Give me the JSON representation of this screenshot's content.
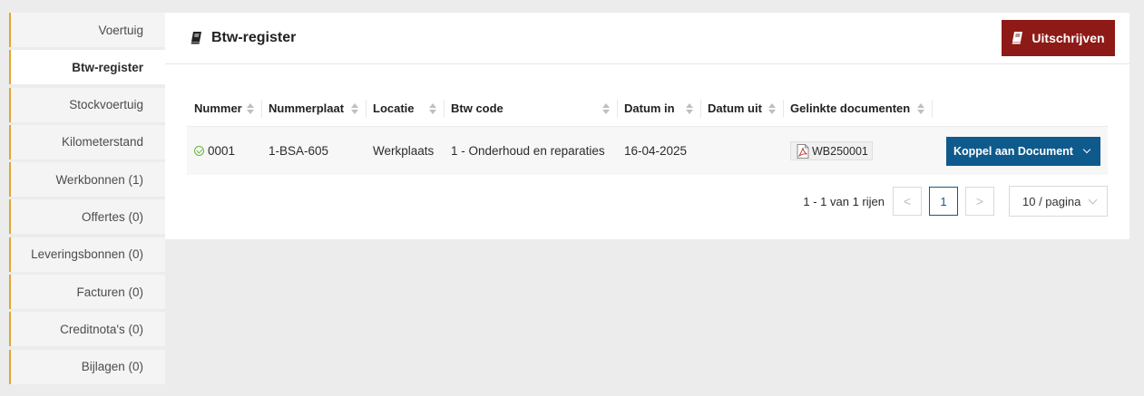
{
  "sidebar": {
    "items": [
      {
        "label": "Voertuig",
        "active": false
      },
      {
        "label": "Btw-register",
        "active": true
      },
      {
        "label": "Stockvoertuig",
        "active": false
      },
      {
        "label": "Kilometerstand",
        "active": false
      },
      {
        "label": "Werkbonnen (1)",
        "active": false
      },
      {
        "label": "Offertes (0)",
        "active": false
      },
      {
        "label": "Leveringsbonnen (0)",
        "active": false
      },
      {
        "label": "Facturen (0)",
        "active": false
      },
      {
        "label": "Creditnota's (0)",
        "active": false
      },
      {
        "label": "Bijlagen (0)",
        "active": false
      }
    ],
    "accent_color": "#e3a62b"
  },
  "header": {
    "title": "Btw-register",
    "title_icon": "book-icon",
    "action_label": "Uitschrijven",
    "action_icon": "book-icon",
    "action_color": "#8e1a17"
  },
  "table": {
    "columns": [
      "Nummer",
      "Nummerplaat",
      "Locatie",
      "Btw code",
      "Datum in",
      "Datum uit",
      "Gelinkte documenten"
    ],
    "rows": [
      {
        "status_icon": "check-circle-icon",
        "nummer": "0001",
        "nummerplaat": "1-BSA-605",
        "locatie": "Werkplaats",
        "btw_code": "1 - Onderhoud en reparaties",
        "datum_in": "16-04-2025",
        "datum_uit": "",
        "document": {
          "icon": "pdf-icon",
          "label": "WB250001"
        },
        "action_label": "Koppel aan Document"
      }
    ]
  },
  "pagination": {
    "info": "1 - 1 van 1 rijen",
    "prev": "<",
    "current_page": "1",
    "next": ">",
    "page_size": "10 / pagina"
  },
  "colors": {
    "primary": "#0f5a8c",
    "danger": "#8e1a17",
    "success": "#6bb43a"
  }
}
